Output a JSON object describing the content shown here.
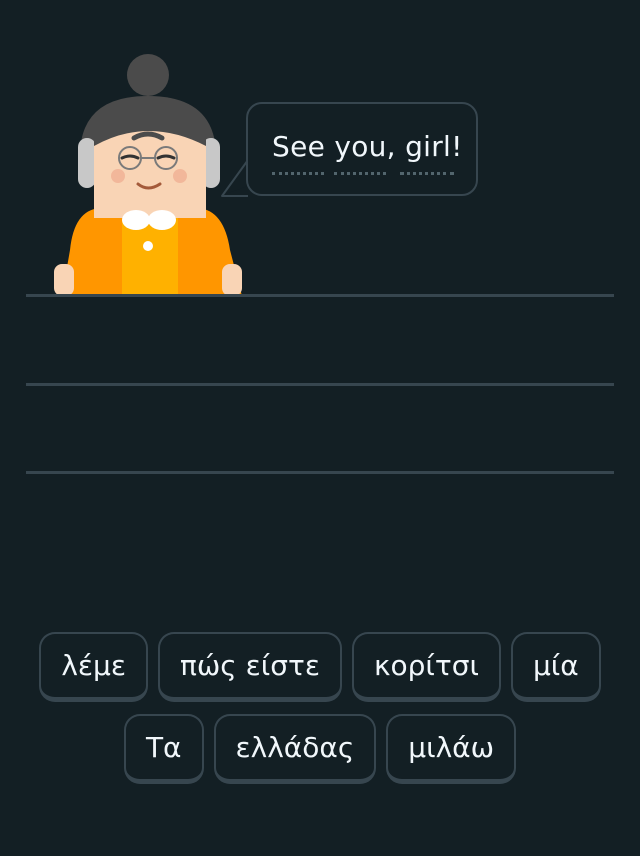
{
  "prompt": {
    "speech": "See you, girl!"
  },
  "word_bank": {
    "row1": [
      "λέμε",
      "πώς είστε",
      "κορίτσι",
      "μία"
    ],
    "row2": [
      "Τα",
      "ελλάδας",
      "μιλάω"
    ]
  },
  "colors": {
    "background": "#131f24",
    "border": "#37464f",
    "text": "#f1f7fb",
    "dress": "#ff9600",
    "skin": "#f9d4b5",
    "hair": "#4b4b4b"
  }
}
